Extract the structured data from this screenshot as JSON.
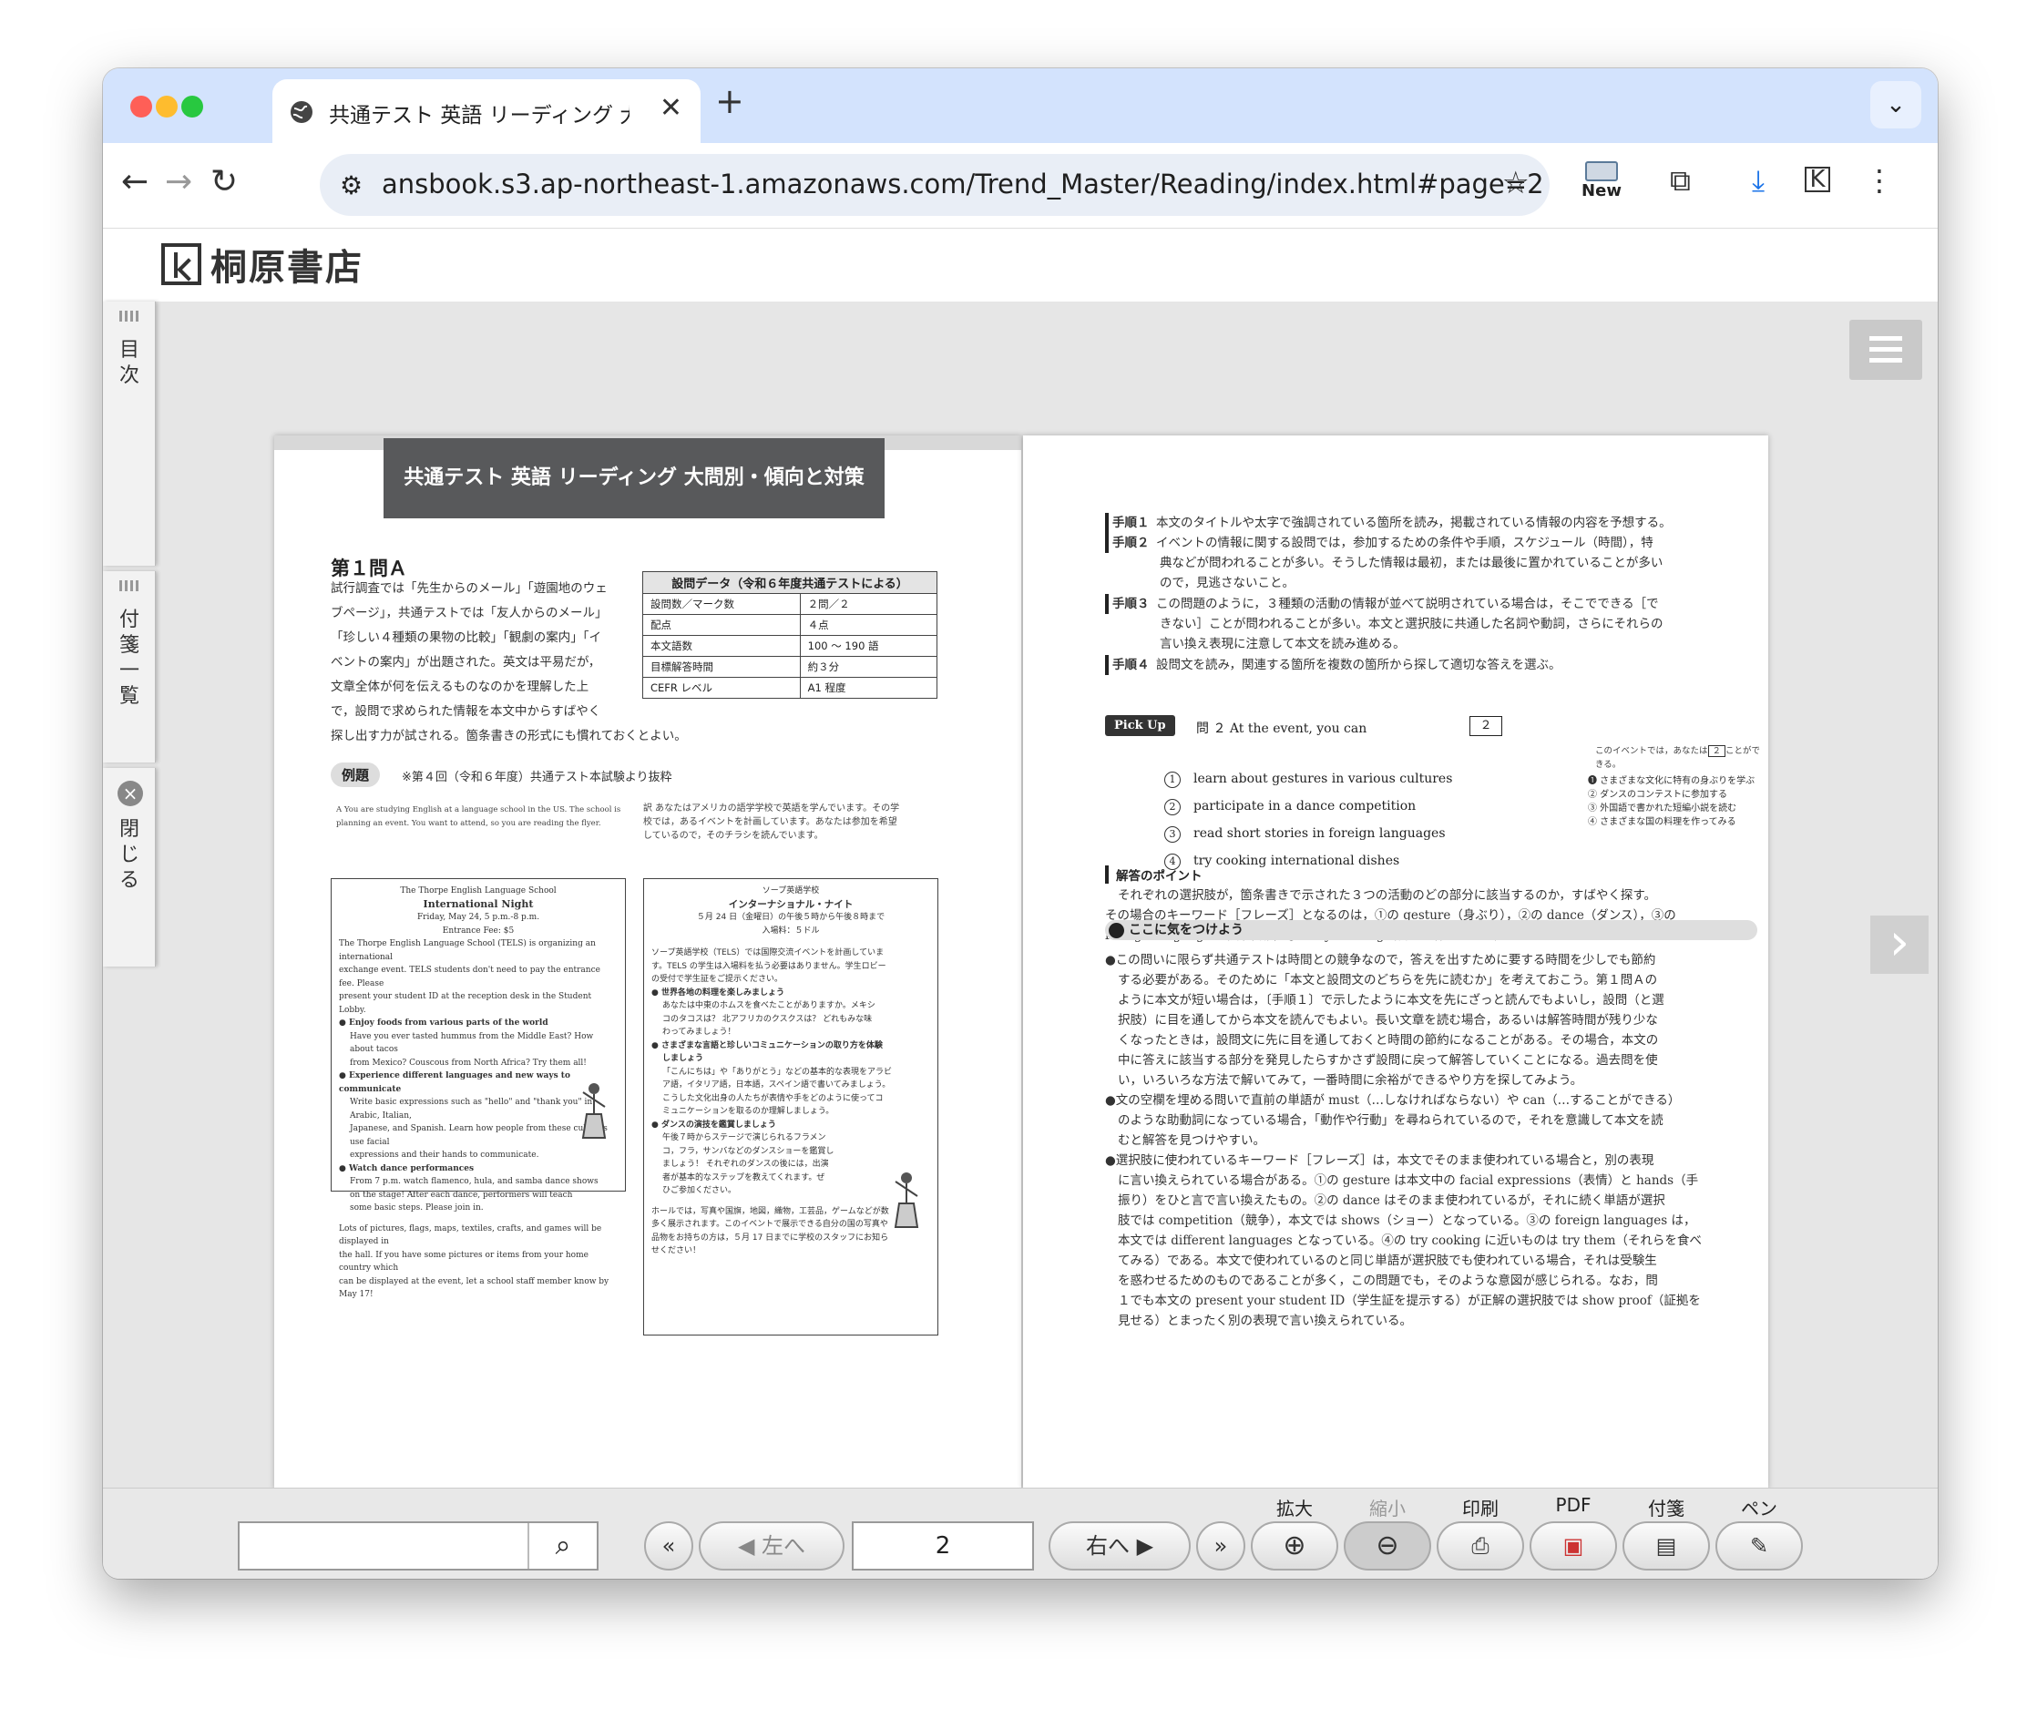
{
  "browser": {
    "tab_title": "共通テスト 英語 リーディング 大",
    "url": "ansbook.s3.ap-northeast-1.amazonaws.com/Trend_Master/Reading/index.html#page=2",
    "new_label": "New"
  },
  "site": {
    "brand": "桐原書店"
  },
  "sidebar": {
    "toc": "目次",
    "sticky": "付箋一覧",
    "close": "閉じる"
  },
  "left_page": {
    "title": "共通テスト 英語 リーディング 大問別・傾向と対策",
    "section": "第１問Ａ",
    "intro": [
      "試行調査では「先生からのメール」「遊園地のウェ",
      "ブページ」，共通テストでは「友人からのメール」",
      "「珍しい４種類の果物の比較」「観劇の案内」「イ",
      "ベントの案内」が出題された。英文は平易だが，",
      "文章全体が何を伝えるものなのかを理解した上",
      "で，設問で求められた情報を本文中からすばやく",
      "探し出す力が試される。箇条書きの形式にも慣れておくとよい。"
    ],
    "table_head": "設問データ（令和６年度共通テストによる）",
    "table": [
      [
        "設問数／マーク数",
        "２問／２"
      ],
      [
        "配点",
        "４点"
      ],
      [
        "本文語数",
        "100 ～ 190 語"
      ],
      [
        "目標解答時間",
        "約３分"
      ],
      [
        "CEFR レベル",
        "A1 程度"
      ]
    ],
    "example_label": "例題",
    "example_note": "※第４回（令和６年度）共通テスト本試験より抜粋",
    "en_lead": [
      "A   You are studying English at a language school in the US. The school is",
      "planning an event. You want to attend, so you are reading the flyer."
    ],
    "jp_lead": [
      "訳 あなたはアメリカの語学学校で英語を学んでいます。その学",
      "校では，あるイベントを計画しています。あなたは参加を希望",
      "しているので，そのチラシを読んでいます。"
    ],
    "en_flyer": {
      "school": "The Thorpe English Language School",
      "event": "International Night",
      "date": "Friday, May 24, 5 p.m.-8 p.m.",
      "fee": "Entrance Fee: $5",
      "body": [
        "The Thorpe English Language School (TELS) is organizing an international",
        "exchange event. TELS students don't need to pay the entrance fee. Please",
        "present your student ID at the reception desk in the Student Lobby."
      ],
      "b1": "Enjoy foods from various parts of the world",
      "b1t": [
        "Have you ever tasted hummus from the Middle East? How about tacos",
        "from Mexico? Couscous from North Africa? Try them all!"
      ],
      "b2": "Experience different languages and new ways to communicate",
      "b2t": [
        "Write basic expressions such as \"hello\" and \"thank you\" in Arabic, Italian,",
        "Japanese, and Spanish. Learn how people from these cultures use facial",
        "expressions and their hands to communicate."
      ],
      "b3": "Watch dance performances",
      "b3t": [
        "From 7 p.m. watch flamenco, hula, and samba dance shows",
        "on the stage! After each dance, performers will teach",
        "some basic steps. Please join in."
      ],
      "foot": [
        "Lots of pictures, flags, maps, textiles, crafts, and games will be displayed in",
        "the hall. If you have some pictures or items from your home country which",
        "can be displayed at the event, let a school staff member know by May 17!"
      ]
    },
    "jp_flyer": {
      "school": "ソープ英語学校",
      "event": "インターナショナル・ナイト",
      "date": "５月 24 日（金曜日）の午後５時から午後８時まで",
      "fee": "入場料：５ドル",
      "body": [
        "ソープ英語学校（TELS）では国際交流イベントを計画していま",
        "す。TELS の学生は入場料を払う必要はありません。学生ロビー",
        "の受付で学生証をご提示ください。"
      ],
      "b1": "世界各地の料理を楽しみましょう",
      "b1t": [
        "あなたは中東のホムスを食べたことがありますか。メキシ",
        "コのタコスは？ 北アフリカのクスクスは？ どれもみな味",
        "わってみましょう！"
      ],
      "b2": "さまざまな言語と珍しいコミュニケーションの取り方を体験",
      "b2b": "しましょう",
      "b2t": [
        "「こんにちは」や「ありがとう」などの基本的な表現をアラビ",
        "ア語，イタリア語，日本語，スペイン語で書いてみましょう。",
        "こうした文化出身の人たちが表情や手をどのように使ってコ",
        "ミュニケーションを取るのか理解しましょう。"
      ],
      "b3": "ダンスの演技を鑑賞しましょう",
      "b3t": [
        "午後７時からステージで演じられるフラメン",
        "コ，フラ，サンバなどのダンスショーを鑑賞し",
        "ましょう！ それぞれのダンスの後には，出演",
        "者が基本的なステップを教えてくれます。ぜ",
        "ひご参加ください。"
      ],
      "foot": [
        "ホールでは，写真や国旗，地図，織物，工芸品，ゲームなどが数",
        "多く展示されます。このイベントで展示できる自分の国の写真や",
        "品物をお持ちの方は，５月 17 日までに学校のスタッフにお知ら",
        "せください！"
      ]
    }
  },
  "right_page": {
    "steps": [
      {
        "k": "手順１",
        "t": [
          "本文のタイトルや太字で強調されている箇所を読み，掲載されている情報の内容を予想する。"
        ]
      },
      {
        "k": "手順２",
        "t": [
          "イベントの情報に関する設問では，参加するための条件や手順，スケジュール（時間），特",
          "典などが問われることが多い。そうした情報は最初，または最後に置かれていることが多い",
          "ので，見逃さないこと。"
        ]
      },
      {
        "k": "手順３",
        "t": [
          "この問題のように，３種類の活動の情報が並べて説明されている場合は，そこでできる［で",
          "きない］ことが問われることが多い。本文と選択肢に共通した名詞や動詞，さらにそれらの",
          "言い換え表現に注意して本文を読み進める。"
        ]
      },
      {
        "k": "手順４",
        "t": [
          "設問文を読み，関連する箇所を複数の箇所から探して適切な答えを選ぶ。"
        ]
      }
    ],
    "pickup": "Pick Up",
    "question": "問 ２   At the event, you can",
    "answer_box": "２",
    "jp_question": "このイベントでは，あなたは",
    "jp_q_box": "２",
    "jp_q_tail": "ことができる。",
    "options": [
      "learn about gestures in various cultures",
      "participate in a dance competition",
      "read short stories in foreign languages",
      "try cooking international dishes"
    ],
    "option_nums": [
      "1",
      "2",
      "3",
      "4"
    ],
    "jp_options": [
      "❶ さまざまな文化に特有の身ぶりを学ぶ",
      "② ダンスのコンテストに参加する",
      "③ 外国語で書かれた短編小説を読む",
      "④ さまざまな国の料理を作ってみる"
    ],
    "point_head": "解答のポイント",
    "point": [
      "それぞれの選択肢が，箇条書きで示された３つの活動のどの部分に該当するのか，すばやく探す。",
      "その場合のキーワード［フレーズ］となるのは，①の gesture（身ぶり），②の dance（ダンス），③の",
      "foreign languages（外国語），④の try cooking（料理を作ってみる）である。"
    ],
    "caution_head": "ここに気をつけよう",
    "caution": [
      "●この問いに限らず共通テストは時間との競争なので，答えを出すために要する時間を少しでも節約",
      "する必要がある。そのために「本文と設問文のどちらを先に読むか」を考えておこう。第１問Ａの",
      "ように本文が短い場合は，〔手順１〕で示したように本文を先にざっと読んでもよいし，設問（と選",
      "択肢）に目を通してから本文を読んでもよい。長い文章を読む場合，あるいは解答時間が残り少な",
      "くなったときは，設問文に先に目を通しておくと時間の節約になることがある。その場合，本文の",
      "中に答えに該当する部分を発見したらすかさず設問に戻って解答していくことになる。過去問を使",
      "い，いろいろな方法で解いてみて，一番時間に余裕ができるやり方を探してみよう。",
      "●文の空欄を埋める問いで直前の単語が must（…しなければならない）や can（…することができる）",
      "のような助動詞になっている場合，「動作や行動」を尋ねられているので，それを意識して本文を読",
      "むと解答を見つけやすい。",
      "●選択肢に使われているキーワード［フレーズ］は，本文でそのまま使われている場合と，別の表現",
      "に言い換えられている場合がある。①の gesture は本文中の facial expressions（表情）と hands（手",
      "振り）をひと言で言い換えたもの。②の dance はそのまま使われているが，それに続く単語が選択",
      "肢では competition（競争），本文では shows（ショー）となっている。③の foreign languages は，",
      "本文では different languages となっている。④の try cooking に近いものは try them（それらを食べ",
      "てみる）である。本文で使われているのと同じ単語が選択肢でも使われている場合，それは受験生",
      "を惑わせるためのものであることが多く，この問題でも，そのような意図が感じられる。なお，問",
      "１でも本文の present your student ID（学生証を提示する）が正解の選択肢では show proof（証拠を",
      "見せる）とまったく別の表現で言い換えられている。"
    ]
  },
  "bottombar": {
    "left": "左へ",
    "right": "右へ",
    "page": "2",
    "zoom_in": "拡大",
    "zoom_out": "縮小",
    "print": "印刷",
    "pdf": "PDF",
    "sticky": "付箋",
    "pen": "ペン"
  }
}
